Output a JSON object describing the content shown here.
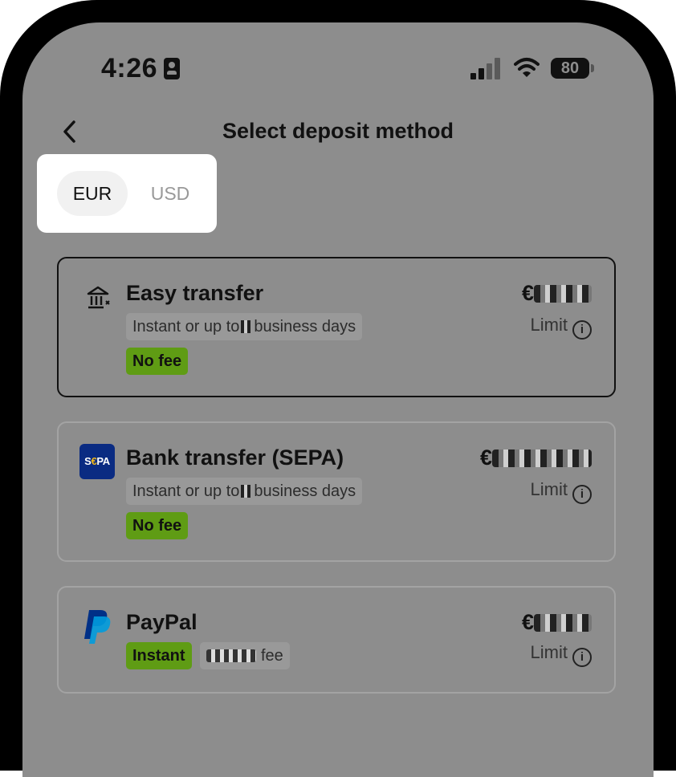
{
  "status_bar": {
    "time": "4:26",
    "battery": "80"
  },
  "header": {
    "title": "Select deposit method"
  },
  "currency_toggle": {
    "options": [
      "EUR",
      "USD"
    ],
    "selected": "EUR"
  },
  "methods": [
    {
      "name": "Easy transfer",
      "icon": "bank-icon",
      "timing": "Instant or up to",
      "timing_suffix": "business days",
      "fee": "No fee",
      "amount_prefix": "€",
      "limit_label": "Limit"
    },
    {
      "name": "Bank transfer (SEPA)",
      "icon": "sepa-icon",
      "icon_text": "S€PA",
      "timing": "Instant or up to",
      "timing_suffix": "business days",
      "fee": "No fee",
      "amount_prefix": "€",
      "limit_label": "Limit"
    },
    {
      "name": "PayPal",
      "icon": "paypal-icon",
      "badge": "Instant",
      "fee_suffix": "fee",
      "amount_prefix": "€",
      "limit_label": "Limit"
    }
  ],
  "colors": {
    "overlay_gray": "#8d8d8d",
    "fee_green": "#5f9c14",
    "sepa_blue": "#0a2b82",
    "paypal_dark": "#003087",
    "paypal_light": "#009cde"
  }
}
